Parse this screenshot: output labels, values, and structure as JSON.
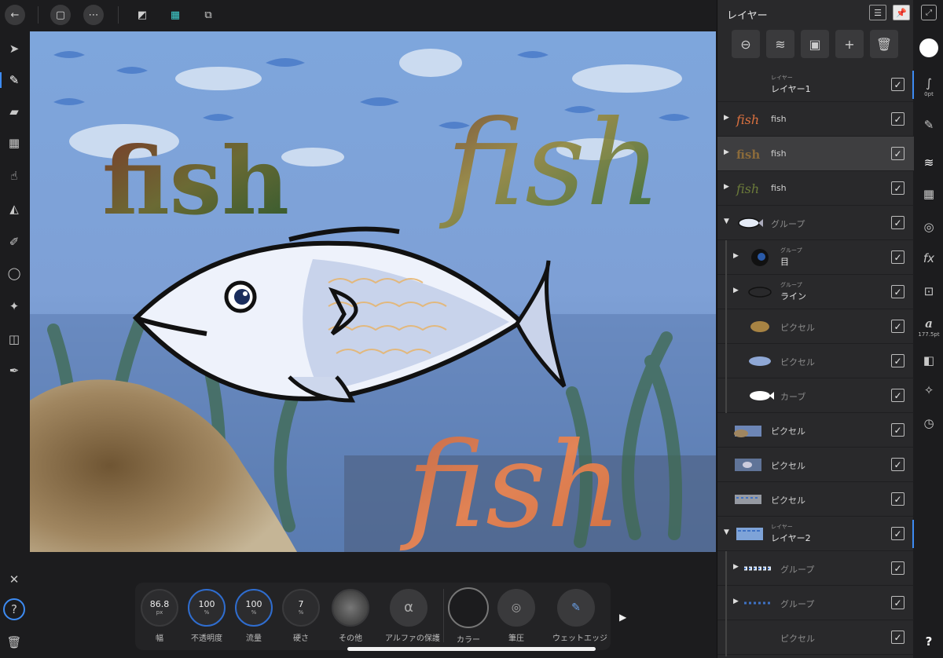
{
  "top_bar": {
    "icons": [
      "back-arrow-icon",
      "document-icon",
      "more-icon",
      "persona-draw-icon",
      "persona-pixel-icon",
      "persona-export-icon"
    ]
  },
  "left_tools": [
    "move-tool-icon",
    "paint-brush-icon",
    "eraser-icon",
    "mosaic-icon",
    "smudge-icon",
    "fill-bucket-icon",
    "dodge-brush-icon",
    "lasso-icon",
    "magic-wand-icon",
    "marquee-icon",
    "color-picker-icon"
  ],
  "left_bottom": [
    "close-icon",
    "help-hint-icon",
    "trash-icon"
  ],
  "canvas": {
    "text_fish_1": "fish",
    "text_fish_2": "fish",
    "text_fish_3": "fish"
  },
  "context_bar": {
    "width": {
      "value": "86.8",
      "unit": "px",
      "label": "幅",
      "level": 0.3
    },
    "opacity": {
      "value": "100",
      "unit": "%",
      "label": "不透明度",
      "level": 1.0
    },
    "flow": {
      "value": "100",
      "unit": "%",
      "label": "流量",
      "level": 1.0
    },
    "hardness": {
      "value": "7",
      "unit": "%",
      "label": "硬さ",
      "level": 0.07
    },
    "other": {
      "label": "その他"
    },
    "alpha_protect": {
      "symbol": "α",
      "label": "アルファの保護"
    },
    "color": {
      "label": "カラー"
    },
    "pressure": {
      "label": "筆圧"
    },
    "wet_edge": {
      "label": "ウェットエッジ"
    }
  },
  "layers_panel": {
    "title": "レイヤー",
    "layers": [
      {
        "small": "レイヤー",
        "name": "レイヤー1",
        "checked": "✓"
      },
      {
        "name": "fish",
        "checked": "✓"
      },
      {
        "name": "fish",
        "checked": "✓"
      },
      {
        "name": "fish",
        "checked": "✓"
      },
      {
        "name": "グループ",
        "checked": "✓"
      },
      {
        "small": "グループ",
        "name": "目",
        "checked": "✓"
      },
      {
        "small": "グループ",
        "name": "ライン",
        "checked": "✓"
      },
      {
        "name": "ピクセル",
        "checked": "✓"
      },
      {
        "name": "ピクセル",
        "checked": "✓"
      },
      {
        "name": "カーブ",
        "checked": "✓"
      },
      {
        "name": "ピクセル",
        "checked": "✓"
      },
      {
        "name": "ピクセル",
        "checked": "✓"
      },
      {
        "name": "ピクセル",
        "checked": "✓"
      },
      {
        "small": "レイヤー",
        "name": "レイヤー2",
        "checked": "✓"
      },
      {
        "name": "グループ",
        "checked": "✓"
      },
      {
        "name": "グループ",
        "checked": "✓"
      },
      {
        "name": "ピクセル",
        "checked": "✓"
      }
    ]
  },
  "studio_bar": {
    "brush_size": "0pt",
    "font_size": "177.5pt",
    "font_glyph": "a",
    "fx_label": "fx",
    "help": "?"
  },
  "colors": {
    "accent": "#3d8bf2",
    "panel_bg": "#29292b",
    "selected_row": "#3e3e40"
  }
}
